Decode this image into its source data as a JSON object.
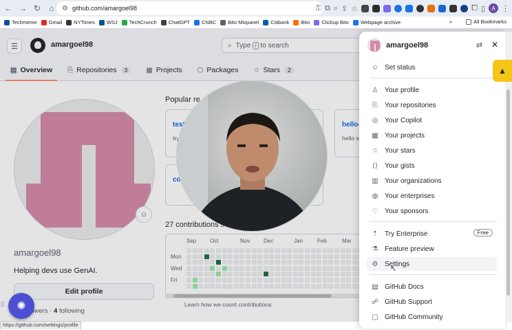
{
  "browser": {
    "url": "github.com/amargoel98",
    "bookmarks": [
      "Techmeme",
      "Gmail",
      "NYTimes",
      "WSJ",
      "TechCrunch",
      "ChatGPT",
      "CNBC",
      "Bito Mixpanel",
      "Citibank",
      "Bito",
      "Clickup Bito",
      "Webpage archive"
    ],
    "bookmark_colors": [
      "#0a4fa0",
      "#d93025",
      "#333333",
      "#0b5394",
      "#2aa846",
      "#3c4043",
      "#1a73e8",
      "#5f6368",
      "#0a5dab",
      "#ff6a00",
      "#7b68ee",
      "#1a73e8"
    ],
    "all_bookmarks": "All Bookmarks",
    "profile_initial": "A",
    "status_url": "https://github.com/settings/profile"
  },
  "header": {
    "username": "amargoel98",
    "search_placeholder_pre": "Type",
    "search_key": "/",
    "search_placeholder_post": "to search",
    "tabs": [
      {
        "label": "Overview",
        "icon": "book-icon"
      },
      {
        "label": "Repositories",
        "count": "3",
        "icon": "repo-icon"
      },
      {
        "label": "Projects",
        "icon": "table-icon"
      },
      {
        "label": "Packages",
        "icon": "package-icon"
      },
      {
        "label": "Stars",
        "count": "2",
        "icon": "star-icon"
      }
    ]
  },
  "profile": {
    "username": "amargoel98",
    "bio": "Helping devs use GenAI.",
    "edit_label": "Edit profile",
    "followers_count": "",
    "followers_label": "llowers",
    "following_count": "4",
    "following_label": "following"
  },
  "main": {
    "popular_heading": "Popular re",
    "cards": [
      {
        "name": "test",
        "desc": "try"
      },
      {
        "name": "hello-",
        "desc": "hello w"
      },
      {
        "name": "co",
        "desc": ""
      }
    ],
    "contributions_heading": "27 contributions in",
    "months": [
      "Sep",
      "Oct",
      "Nov",
      "Dec",
      "Jan",
      "Feb",
      "Mar"
    ],
    "days": [
      "Mon",
      "Wed",
      "Fri"
    ],
    "learn_link": "Learn how we count contributions"
  },
  "panel": {
    "username": "amargoel98",
    "groups": [
      [
        {
          "label": "Set status",
          "icon": "smiley-icon"
        }
      ],
      [
        {
          "label": "Your profile",
          "icon": "person-icon"
        },
        {
          "label": "Your repositories",
          "icon": "repo-icon"
        },
        {
          "label": "Your Copilot",
          "icon": "copilot-icon"
        },
        {
          "label": "Your projects",
          "icon": "table-icon"
        },
        {
          "label": "Your stars",
          "icon": "star-icon"
        },
        {
          "label": "Your gists",
          "icon": "code-square-icon"
        },
        {
          "label": "Your organizations",
          "icon": "organization-icon"
        },
        {
          "label": "Your enterprises",
          "icon": "globe-icon"
        },
        {
          "label": "Your sponsors",
          "icon": "heart-icon"
        }
      ],
      [
        {
          "label": "Try Enterprise",
          "icon": "upload-icon",
          "badge": "Free"
        },
        {
          "label": "Feature preview",
          "icon": "beaker-icon"
        },
        {
          "label": "Settings",
          "icon": "gear-icon"
        }
      ],
      [
        {
          "label": "GitHub Docs",
          "icon": "book-icon"
        },
        {
          "label": "GitHub Support",
          "icon": "people-icon"
        },
        {
          "label": "GitHub Community",
          "icon": "comment-icon"
        }
      ]
    ]
  },
  "colors": {
    "accent_underline": "#fd8c73",
    "link": "#0969da",
    "avatar_pink": "#d68aa8",
    "contrib_green_dark": "#216e39",
    "contrib_green_light": "#9be9a8"
  }
}
